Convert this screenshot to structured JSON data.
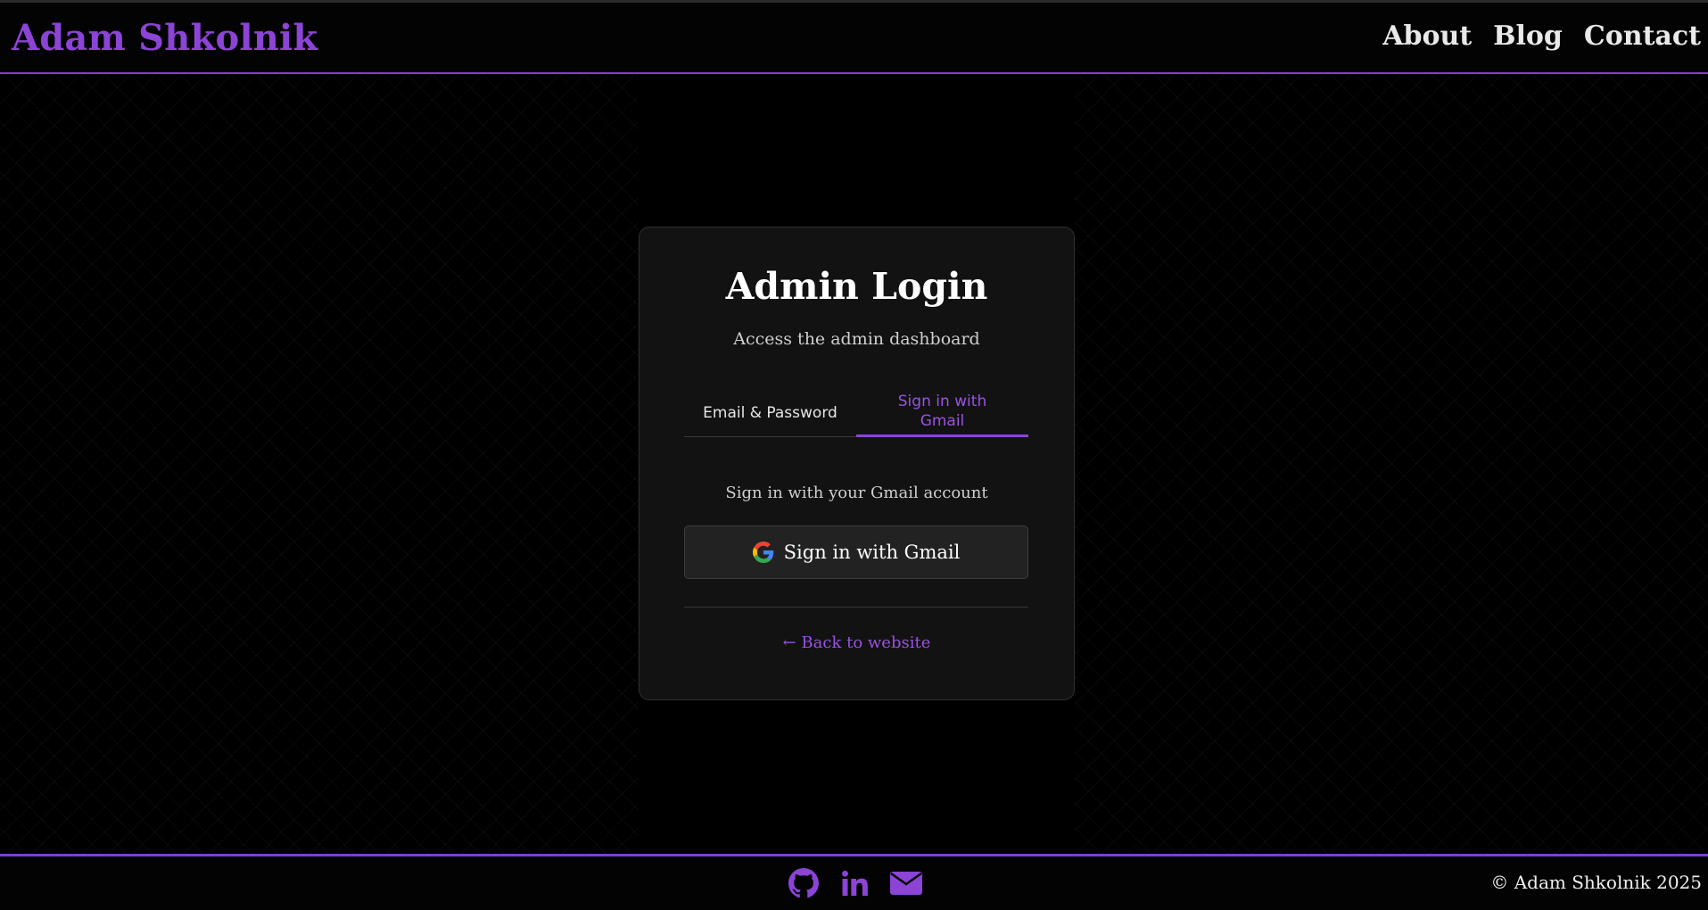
{
  "header": {
    "brand": "Adam Shkolnik",
    "nav": [
      {
        "label": "About"
      },
      {
        "label": "Blog"
      },
      {
        "label": "Contact"
      }
    ]
  },
  "login": {
    "title": "Admin Login",
    "subtitle": "Access the admin dashboard",
    "tabs": [
      {
        "label": "Email & Password",
        "active": false
      },
      {
        "label": "Sign in with Gmail",
        "active": true
      }
    ],
    "gmail_prompt": "Sign in with your Gmail account",
    "gmail_button_label": "Sign in with Gmail",
    "gmail_icon": "google-g-icon",
    "back_link": "← Back to website"
  },
  "footer": {
    "socials": [
      {
        "icon": "github-icon"
      },
      {
        "icon": "linkedin-icon"
      },
      {
        "icon": "envelope-icon"
      }
    ],
    "copyright": "© Adam Shkolnik 2025"
  },
  "colors": {
    "accent": "#8b44d6",
    "background": "#000000",
    "card": "#121212",
    "button": "#222222"
  }
}
